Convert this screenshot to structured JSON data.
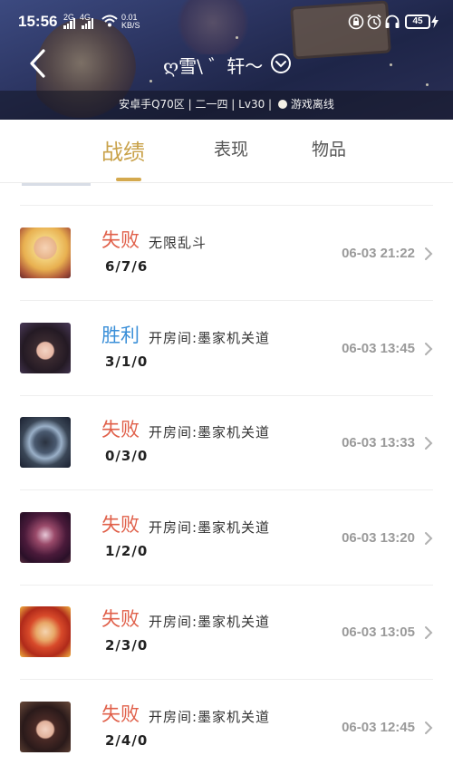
{
  "status_bar": {
    "time": "15:56",
    "signal1_label": "2G",
    "signal2_label": "4G",
    "network_speed_value": "0.01",
    "network_speed_unit": "KB/S",
    "battery": "45"
  },
  "header": {
    "player_name": "ღ雪\\ ゛轩〜",
    "subtitle_text": "安卓手Q70区 | 二一四 | Lv30 | ",
    "status_text": "游戏离线"
  },
  "tabs": [
    {
      "label": "战绩",
      "active": true
    },
    {
      "label": "表现",
      "active": false
    },
    {
      "label": "物品",
      "active": false
    }
  ],
  "colors": {
    "accent_gold": "#c9a24a",
    "defeat": "#e0604a",
    "victory": "#3a8fd8",
    "time_gray": "#9a9a9a"
  },
  "matches": [
    {
      "result": "失败",
      "outcome": "defeat",
      "mode": "无限乱斗",
      "kda": "6/7/6",
      "time": "06-03 21:22",
      "hero_icon": "hero-portrait-blonde"
    },
    {
      "result": "胜利",
      "outcome": "victory",
      "mode": "开房间:墨家机关道",
      "kda": "3/1/0",
      "time": "06-03 13:45",
      "hero_icon": "hero-portrait-dark-hair"
    },
    {
      "result": "失败",
      "outcome": "defeat",
      "mode": "开房间:墨家机关道",
      "kda": "0/3/0",
      "time": "06-03 13:33",
      "hero_icon": "hero-portrait-masked"
    },
    {
      "result": "失败",
      "outcome": "defeat",
      "mode": "开房间:墨家机关道",
      "kda": "1/2/0",
      "time": "06-03 13:20",
      "hero_icon": "hero-portrait-demon"
    },
    {
      "result": "失败",
      "outcome": "defeat",
      "mode": "开房间:墨家机关道",
      "kda": "2/3/0",
      "time": "06-03 13:05",
      "hero_icon": "hero-portrait-red-hair"
    },
    {
      "result": "失败",
      "outcome": "defeat",
      "mode": "开房间:墨家机关道",
      "kda": "2/4/0",
      "time": "06-03 12:45",
      "hero_icon": "hero-portrait-brunette"
    }
  ]
}
